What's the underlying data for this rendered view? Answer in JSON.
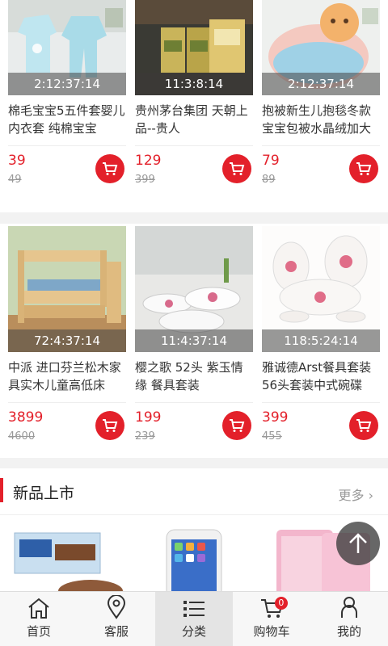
{
  "products_row1": [
    {
      "title": "棉毛宝宝5五件套婴儿内衣套 纯棉宝宝",
      "timer": "2:12:37:14",
      "price": "39",
      "old_price": "49"
    },
    {
      "title": "贵州茅台集团 天朝上品--贵人",
      "timer": "11:3:8:14",
      "price": "129",
      "old_price": "399"
    },
    {
      "title": "抱被新生儿抱毯冬款宝宝包被水晶绒加大",
      "timer": "2:12:37:14",
      "price": "79",
      "old_price": "89"
    }
  ],
  "products_row2": [
    {
      "title": "中派 进口芬兰松木家具实木儿童高低床",
      "timer": "72:4:37:14",
      "price": "3899",
      "old_price": "4600"
    },
    {
      "title": "樱之歌 52头 紫玉情缘 餐具套装",
      "timer": "11:4:37:14",
      "price": "199",
      "old_price": "239"
    },
    {
      "title": "雅诚德Arst餐具套装56头套装中式碗碟",
      "timer": "118:5:24:14",
      "price": "399",
      "old_price": "455"
    }
  ],
  "new_section": {
    "title": "新品上市",
    "more": "更多"
  },
  "tabs": [
    {
      "label": "首页",
      "icon": "home-icon"
    },
    {
      "label": "客服",
      "icon": "location-pin-icon"
    },
    {
      "label": "分类",
      "icon": "list-icon"
    },
    {
      "label": "购物车",
      "icon": "cart-icon",
      "badge": "0"
    },
    {
      "label": "我的",
      "icon": "user-icon"
    }
  ],
  "colors": {
    "accent": "#e3202a"
  }
}
